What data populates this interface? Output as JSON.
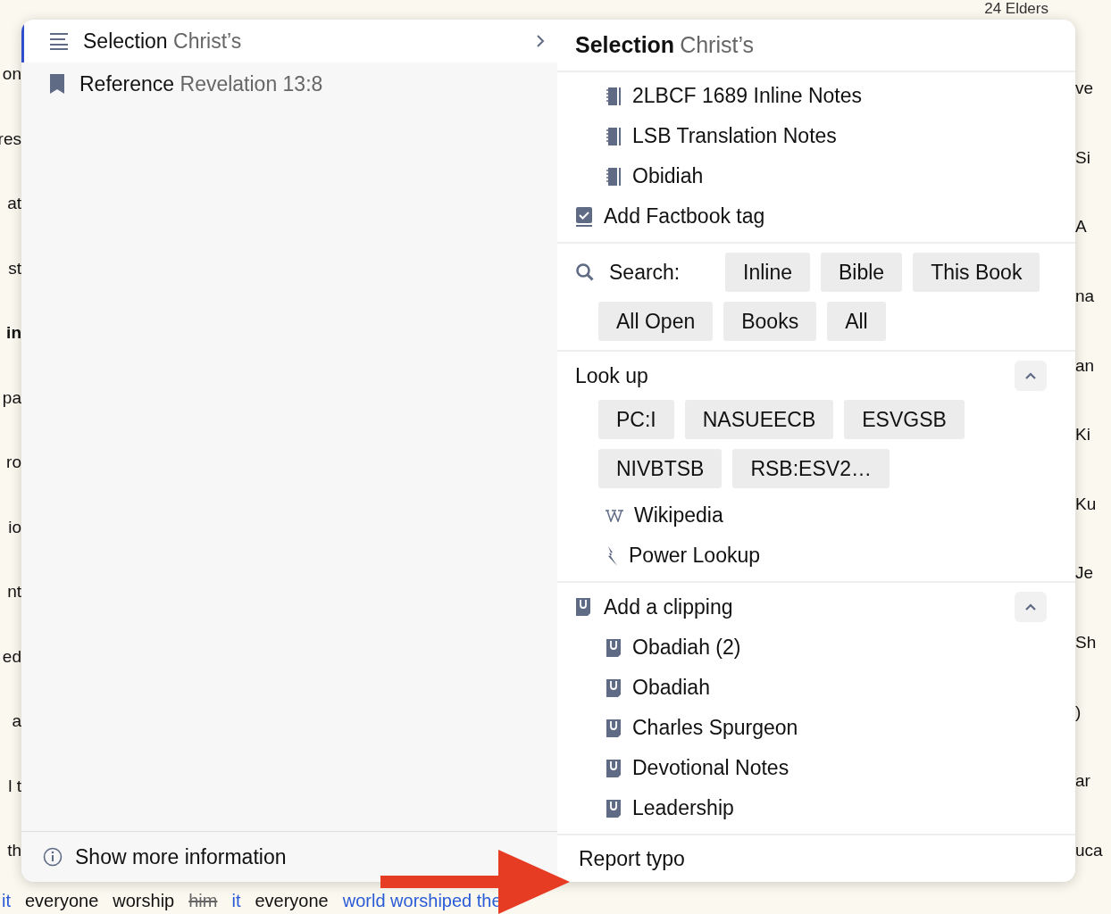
{
  "background": {
    "top_text": "24 Elders",
    "left_fragments": [
      {
        "text": "on",
        "bold": false
      },
      {
        "text": "res",
        "bold": false
      },
      {
        "text": "at",
        "bold": false
      },
      {
        "text": "st",
        "bold": false
      },
      {
        "text": "in",
        "bold": true
      },
      {
        "text": "pa",
        "bold": false
      },
      {
        "text": "ro",
        "bold": false
      },
      {
        "text": "io",
        "bold": false
      },
      {
        "text": "nt",
        "bold": false
      },
      {
        "text": "ed",
        "bold": false
      },
      {
        "text": "a",
        "bold": false
      },
      {
        "text": "l t",
        "bold": false
      },
      {
        "text": "th",
        "bold": false
      }
    ],
    "right_fragments": [
      "ve",
      "Si",
      "A",
      "na",
      "an",
      "Ki",
      "Ku",
      "Je",
      "Sh",
      ")",
      "ar",
      "uca"
    ],
    "bottom_words": [
      {
        "text": "it",
        "kind": "link"
      },
      {
        "text": "everyone",
        "kind": "plain"
      },
      {
        "text": "worship",
        "kind": "plain"
      },
      {
        "text": "him",
        "kind": "struck"
      },
      {
        "text": "it",
        "kind": "link"
      },
      {
        "text": "everyone",
        "kind": "plain"
      },
      {
        "text": "world worshiped the",
        "kind": "link"
      }
    ]
  },
  "menu": {
    "left_items": [
      {
        "kind": "selection",
        "label": "Selection",
        "detail": "Christ’s",
        "selected": true,
        "has_submenu": true
      },
      {
        "kind": "reference",
        "label": "Reference",
        "detail": "Revelation 13:8",
        "selected": false,
        "has_submenu": false
      }
    ],
    "footer": "Show more information",
    "submenu": {
      "title": "Selection",
      "detail": "Christ’s",
      "notes": [
        {
          "kind": "note",
          "label": "2LBCF 1689 Inline Notes"
        },
        {
          "kind": "note",
          "label": "LSB Translation Notes"
        },
        {
          "kind": "note",
          "label": "Obidiah"
        },
        {
          "kind": "tag",
          "label": "Add Factbook tag"
        }
      ],
      "search": {
        "label": "Search:",
        "buttons": [
          "Inline",
          "Bible",
          "This Book",
          "All Open",
          "Books",
          "All"
        ]
      },
      "lookup": {
        "title": "Look up",
        "expanded": true,
        "buttons": [
          "PC:I",
          "NASUEECB",
          "ESVGSB",
          "NIVBTSB",
          "RSB:ESV2…"
        ],
        "links": [
          {
            "kind": "wikipedia",
            "label": "Wikipedia"
          },
          {
            "kind": "power",
            "label": "Power Lookup"
          }
        ]
      },
      "clipping": {
        "title": "Add a clipping",
        "expanded": true,
        "items": [
          "Obadiah (2)",
          "Obadiah",
          "Charles Spurgeon",
          "Devotional Notes",
          "Leadership"
        ]
      },
      "report": "Report typo"
    }
  }
}
